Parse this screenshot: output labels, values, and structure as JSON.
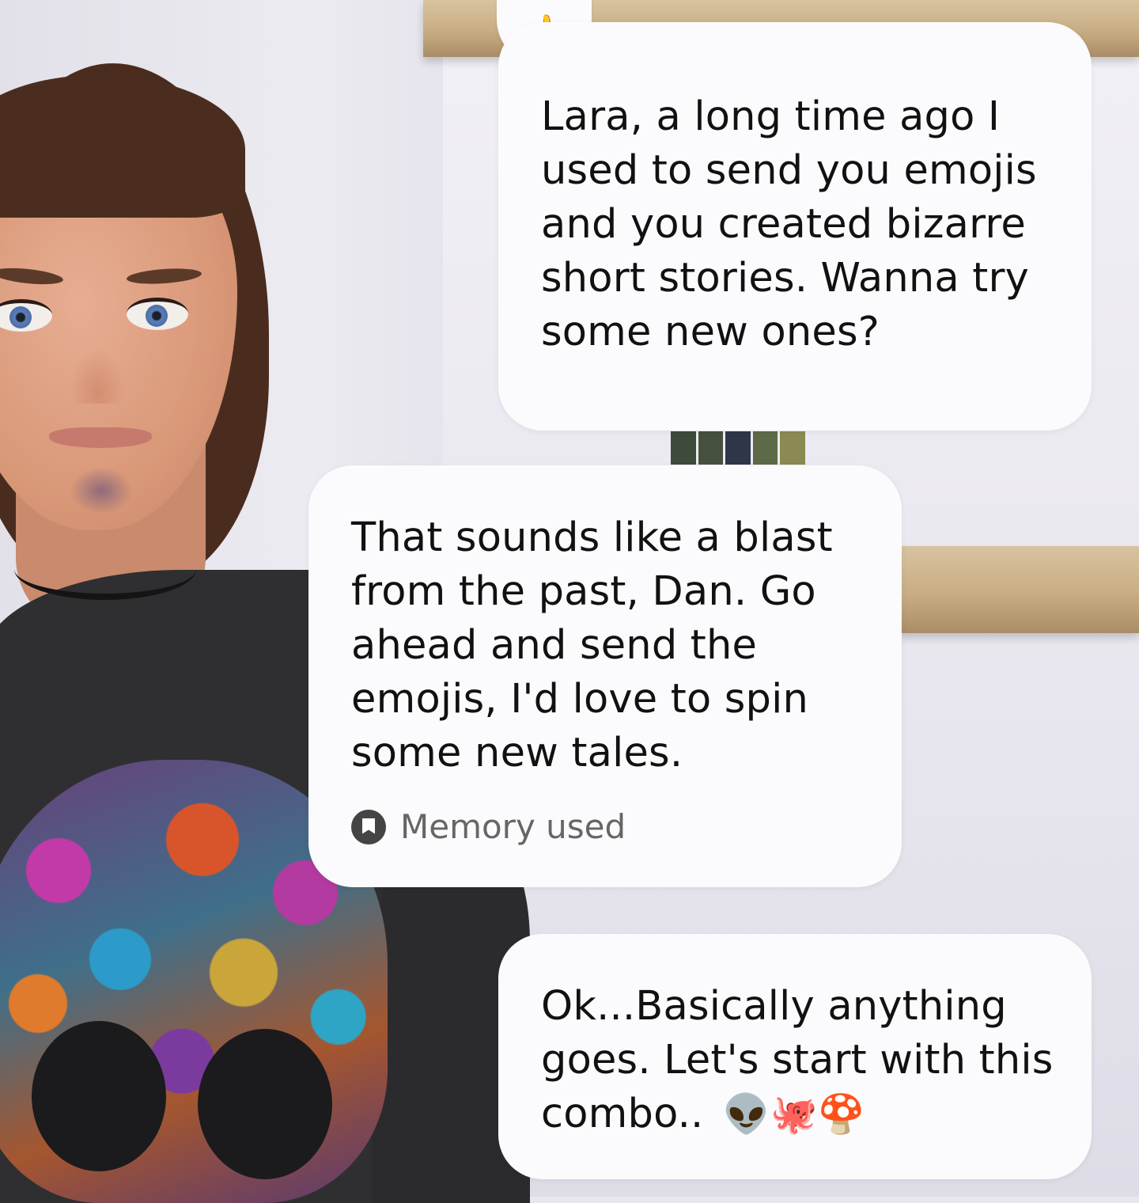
{
  "reaction": {
    "emoji": "👍"
  },
  "messages": [
    {
      "sender": "user",
      "text": "Lara, a long time ago I used to send you emojis and you created bizarre short stories. Wanna try some new ones?"
    },
    {
      "sender": "ai",
      "text": "That sounds like a blast from the past, Dan. Go ahead and send the emojis, I'd love to spin some new tales.",
      "memory_label": "Memory used"
    },
    {
      "sender": "user",
      "text": "Ok...Basically anything goes.  Let's start with this combo..",
      "emojis": "👽🐙🍄"
    }
  ]
}
